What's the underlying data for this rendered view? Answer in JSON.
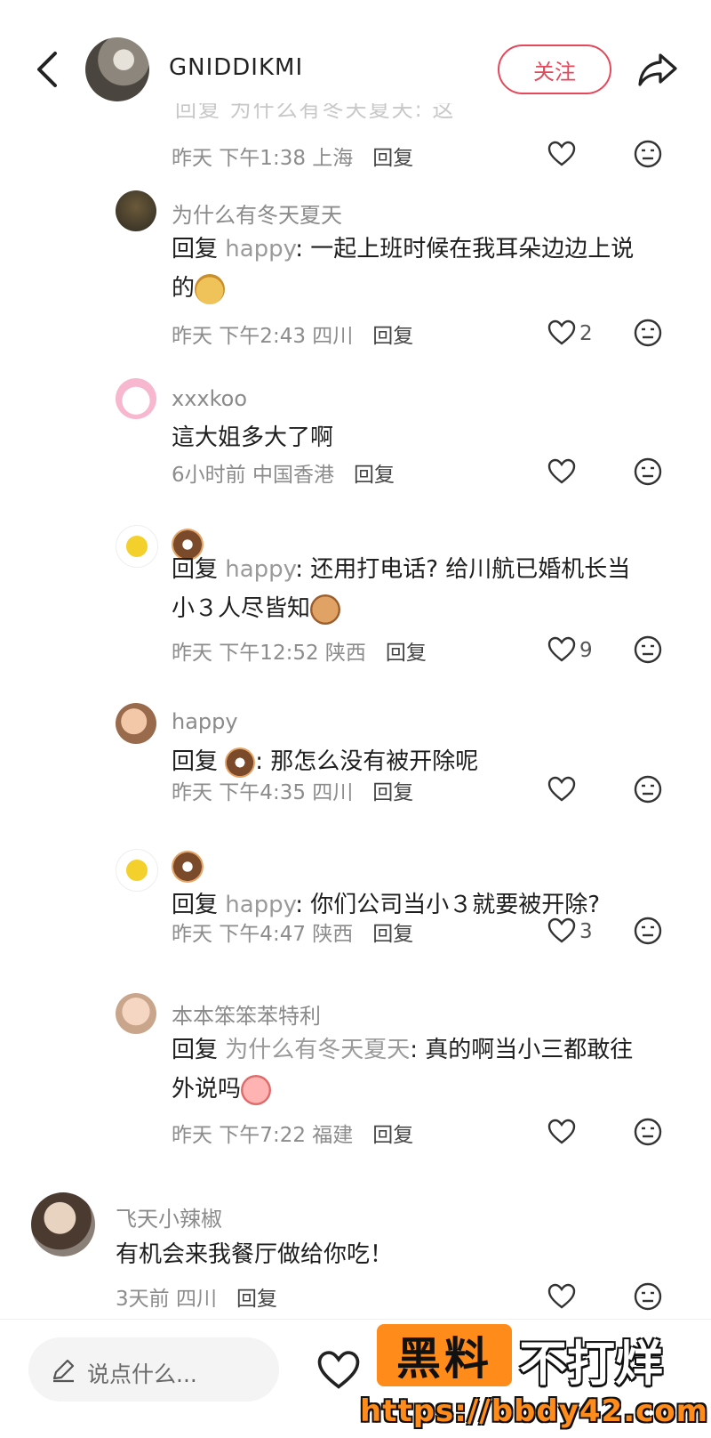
{
  "header": {
    "username": "GNIDDIKMI",
    "follow_label": "关注",
    "clipped_line": "回复 为什么有冬天夏天: 这"
  },
  "comments": [
    {
      "meta_time": "昨天 下午1:38 上海",
      "reply": "回复"
    },
    {
      "user": "为什么有冬天夏天",
      "prefix": "回复 ",
      "target": "happy",
      "text": ": 一起上班时候在我耳朵边边上说",
      "text2": "的",
      "meta_time": "昨天 下午2:43 四川",
      "reply": "回复",
      "likes": "2"
    },
    {
      "user": "xxxkoo",
      "text": "這大姐多大了啊",
      "meta_time": "6小时前 中国香港",
      "reply": "回复"
    },
    {
      "user": "",
      "prefix": "回复 ",
      "target": "happy",
      "text": ": 还用打电话? 给川航已婚机长当",
      "text2": "小３人尽皆知",
      "meta_time": "昨天 下午12:52 陕西",
      "reply": "回复",
      "likes": "9"
    },
    {
      "user": "happy",
      "prefix": "回复 ",
      "text": ": 那怎么没有被开除呢",
      "meta_time": "昨天 下午4:35 四川",
      "reply": "回复"
    },
    {
      "user": "",
      "prefix": "回复 ",
      "target": "happy",
      "text": ": 你们公司当小３就要被开除?",
      "meta_time": "昨天 下午4:47 陕西",
      "reply": "回复",
      "likes": "3"
    },
    {
      "user": "本本笨笨苯特利",
      "prefix": "回复 ",
      "target": "为什么有冬天夏天",
      "text": ": 真的啊当小三都敢往",
      "text2": "外说吗",
      "meta_time": "昨天 下午7:22 福建",
      "reply": "回复"
    },
    {
      "user": "飞天小辣椒",
      "text": "有机会来我餐厅做给你吃！",
      "meta_time": "3天前 四川",
      "reply": "回复"
    }
  ],
  "bottom": {
    "input_placeholder": "说点什么...",
    "watermark_box": "黑料",
    "watermark_text": "不打烊",
    "watermark_url": "https://bbdy42.com"
  },
  "icons": {
    "back": "back-arrow-icon",
    "share": "share-icon",
    "like": "heart-icon",
    "dislike": "dislike-face-icon",
    "edit": "pencil-icon"
  },
  "colors": {
    "accent": "#e5475b",
    "watermark": "#ff8c1a"
  }
}
